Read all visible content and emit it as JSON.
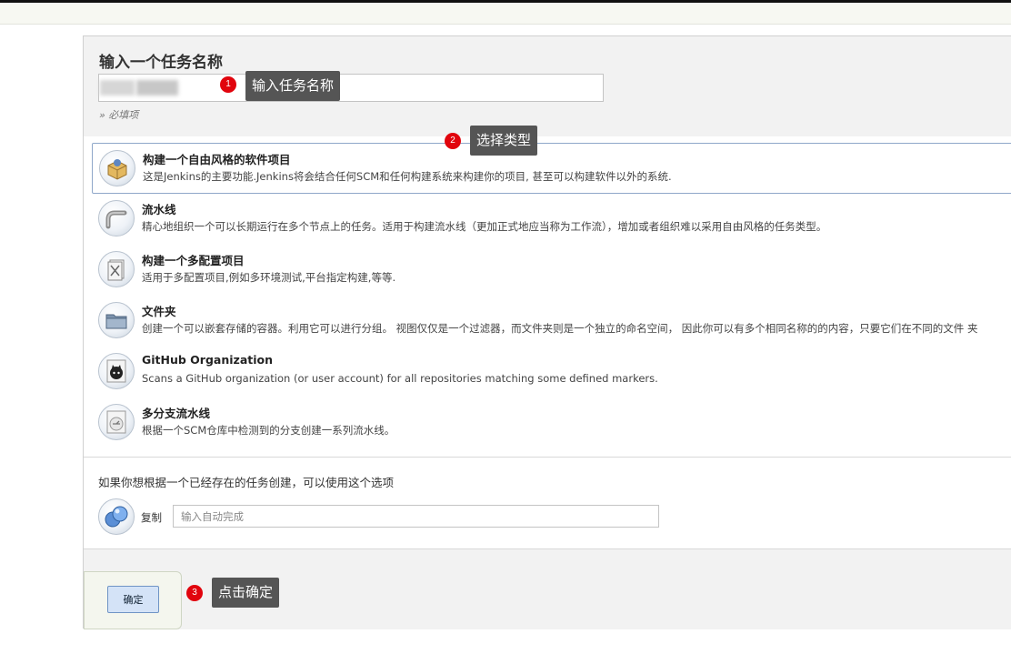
{
  "new_item": {
    "title": "输入一个任务名称",
    "name_value": "",
    "required_hint": "» 必填项"
  },
  "types": [
    {
      "icon": "freestyle-project-icon",
      "title": "构建一个自由风格的软件项目",
      "desc": "这是Jenkins的主要功能.Jenkins将会结合任何SCM和任何构建系统来构建你的项目, 甚至可以构建软件以外的系统.",
      "selected": true
    },
    {
      "icon": "pipeline-icon",
      "title": "流水线",
      "desc": "精心地组织一个可以长期运行在多个节点上的任务。适用于构建流水线（更加正式地应当称为工作流），增加或者组织难以采用自由风格的任务类型。",
      "selected": false
    },
    {
      "icon": "multi-config-icon",
      "title": "构建一个多配置项目",
      "desc": "适用于多配置项目,例如多环境测试,平台指定构建,等等.",
      "selected": false
    },
    {
      "icon": "folder-icon",
      "title": "文件夹",
      "desc": "创建一个可以嵌套存储的容器。利用它可以进行分组。 视图仅仅是一个过滤器，而文件夹则是一个独立的命名空间， 因此你可以有多个相同名称的的内容，只要它们在不同的文件 夹",
      "selected": false
    },
    {
      "icon": "github-org-icon",
      "title": "GitHub Organization",
      "desc": "Scans a GitHub organization (or user account) for all repositories matching some defined markers.",
      "selected": false
    },
    {
      "icon": "multibranch-pipeline-icon",
      "title": "多分支流水线",
      "desc": "根据一个SCM仓库中检测到的分支创建一系列流水线。",
      "selected": false
    }
  ],
  "copy": {
    "hint": "如果你想根据一个已经存在的任务创建，可以使用这个选项",
    "label": "复制",
    "placeholder": "输入自动完成"
  },
  "footer": {
    "ok_label": "确定"
  },
  "annotations": [
    {
      "num": "1",
      "text": "输入任务名称"
    },
    {
      "num": "2",
      "text": "选择类型"
    },
    {
      "num": "3",
      "text": "点击确定"
    }
  ]
}
